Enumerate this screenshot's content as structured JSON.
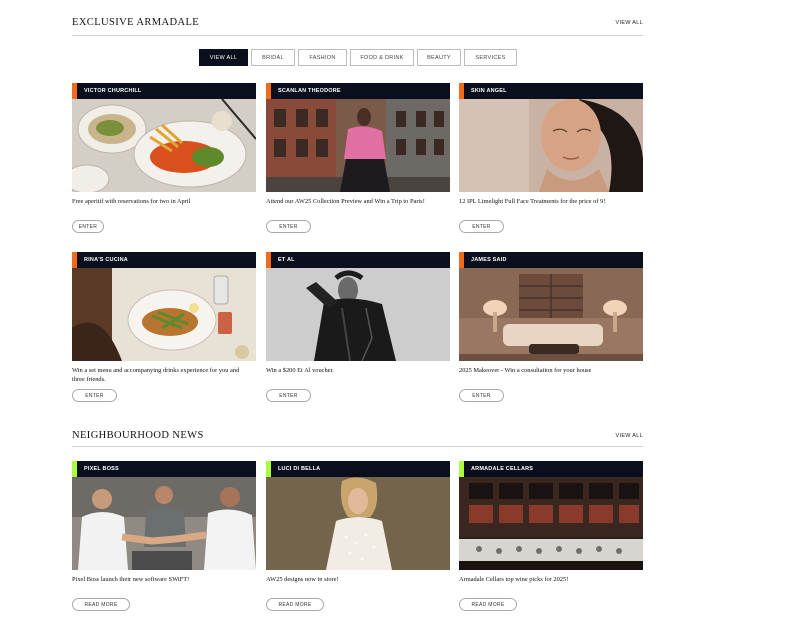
{
  "exclusive": {
    "title": "EXCLUSIVE ARMADALE",
    "view_all": "VIEW ALL",
    "filters": [
      "VIEW ALL",
      "BRIDAL",
      "FASHION",
      "FOOD & DRINK",
      "BEAUTY",
      "SERVICES"
    ],
    "active_filter": "VIEW ALL",
    "cards": [
      {
        "name": "VICTOR CHURCHILL",
        "text": "Free aperitif with reservations for two in April",
        "button": "ENTER"
      },
      {
        "name": "SCANLAN THEODORE",
        "text": "Attend our AW25 Collection Preview and Win a Trip to Paris!",
        "button": "ENTER"
      },
      {
        "name": "SKIN ANGEL",
        "text": "12 IPL Limelight Full Face Treatments for the price of 9!",
        "button": "ENTER"
      },
      {
        "name": "RINA'S CUCINA",
        "text": "Win a set menu and accompanying drinks experience for you and three friends.",
        "button": "ENTER"
      },
      {
        "name": "ET AL",
        "text": "Win a $200 Et Al voucher.",
        "button": "ENTER"
      },
      {
        "name": "JAMES SAID",
        "text": "2025 Makeover - Win a consultation for your house",
        "button": "ENTER"
      }
    ]
  },
  "news": {
    "title": "NEIGHBOURHOOD NEWS",
    "view_all": "VIEW ALL",
    "cards": [
      {
        "name": "PIXEL BOSS",
        "text": "Pixel Boss launch their new software SWiFT!",
        "button": "READ MORE"
      },
      {
        "name": "LUCI DI BELLA",
        "text": "AW25 designs now in store!",
        "button": "READ MORE"
      },
      {
        "name": "ARMADALE CELLARS",
        "text": "Armadale Cellars top wine picks for 2025!",
        "button": "READ MORE"
      }
    ]
  },
  "colors": {
    "header_bg": "#0b0f1d",
    "accent_exclusive": "#f26a1b",
    "accent_news": "#a8ff3e"
  }
}
